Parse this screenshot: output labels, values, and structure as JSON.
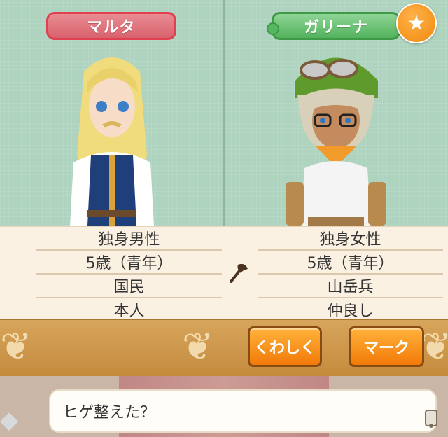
{
  "left_character": {
    "name": "マルタ",
    "rows": [
      "独身男性",
      "5歳（青年）",
      "国民",
      "本人"
    ]
  },
  "right_character": {
    "name": "ガリーナ",
    "rows": [
      "独身女性",
      "5歳（青年）",
      "山岳兵",
      "仲良し"
    ],
    "favorite_icon": "star-icon"
  },
  "center_icon": "axe-icon",
  "buttons": {
    "detail": "くわしく",
    "mark": "マーク"
  },
  "dialog": {
    "text": "ヒゲ整えた？"
  },
  "colors": {
    "left_tag": "#d9626d",
    "right_tag": "#53b25d",
    "button": "#f27a08",
    "bar": "#c48b3d"
  }
}
